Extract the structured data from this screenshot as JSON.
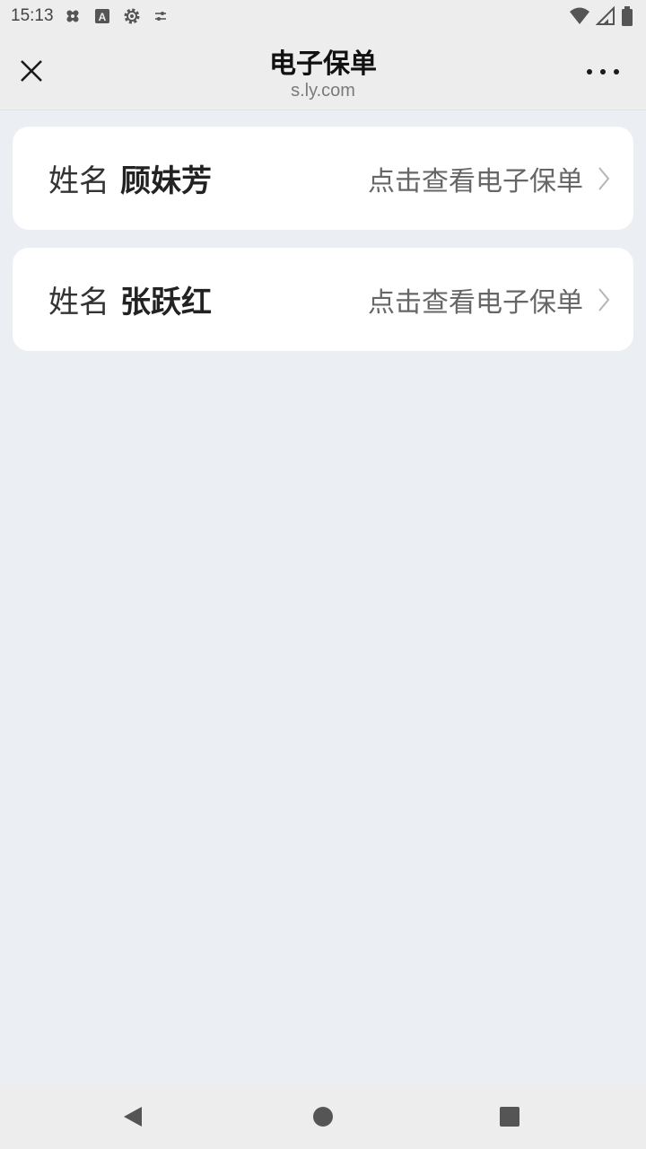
{
  "status_bar": {
    "time": "15:13",
    "icons_left": [
      "bandage-icon",
      "text-a-icon",
      "settings-gear-icon",
      "tune-icon"
    ],
    "icons_right": [
      "wifi-icon",
      "signal-icon",
      "battery-icon"
    ]
  },
  "nav": {
    "title": "电子保单",
    "subtitle": "s.ly.com",
    "close_icon": "close-icon",
    "more_icon": "more-dots-icon"
  },
  "policies": [
    {
      "label": "姓名",
      "name": "顾妹芳",
      "action": "点击查看电子保单"
    },
    {
      "label": "姓名",
      "name": "张跃红",
      "action": "点击查看电子保单"
    }
  ],
  "system_nav": {
    "icons": [
      "back-triangle-icon",
      "home-circle-icon",
      "recents-square-icon"
    ]
  },
  "colors": {
    "background": "#ebeef3",
    "bar": "#ededed",
    "card": "#ffffff"
  }
}
